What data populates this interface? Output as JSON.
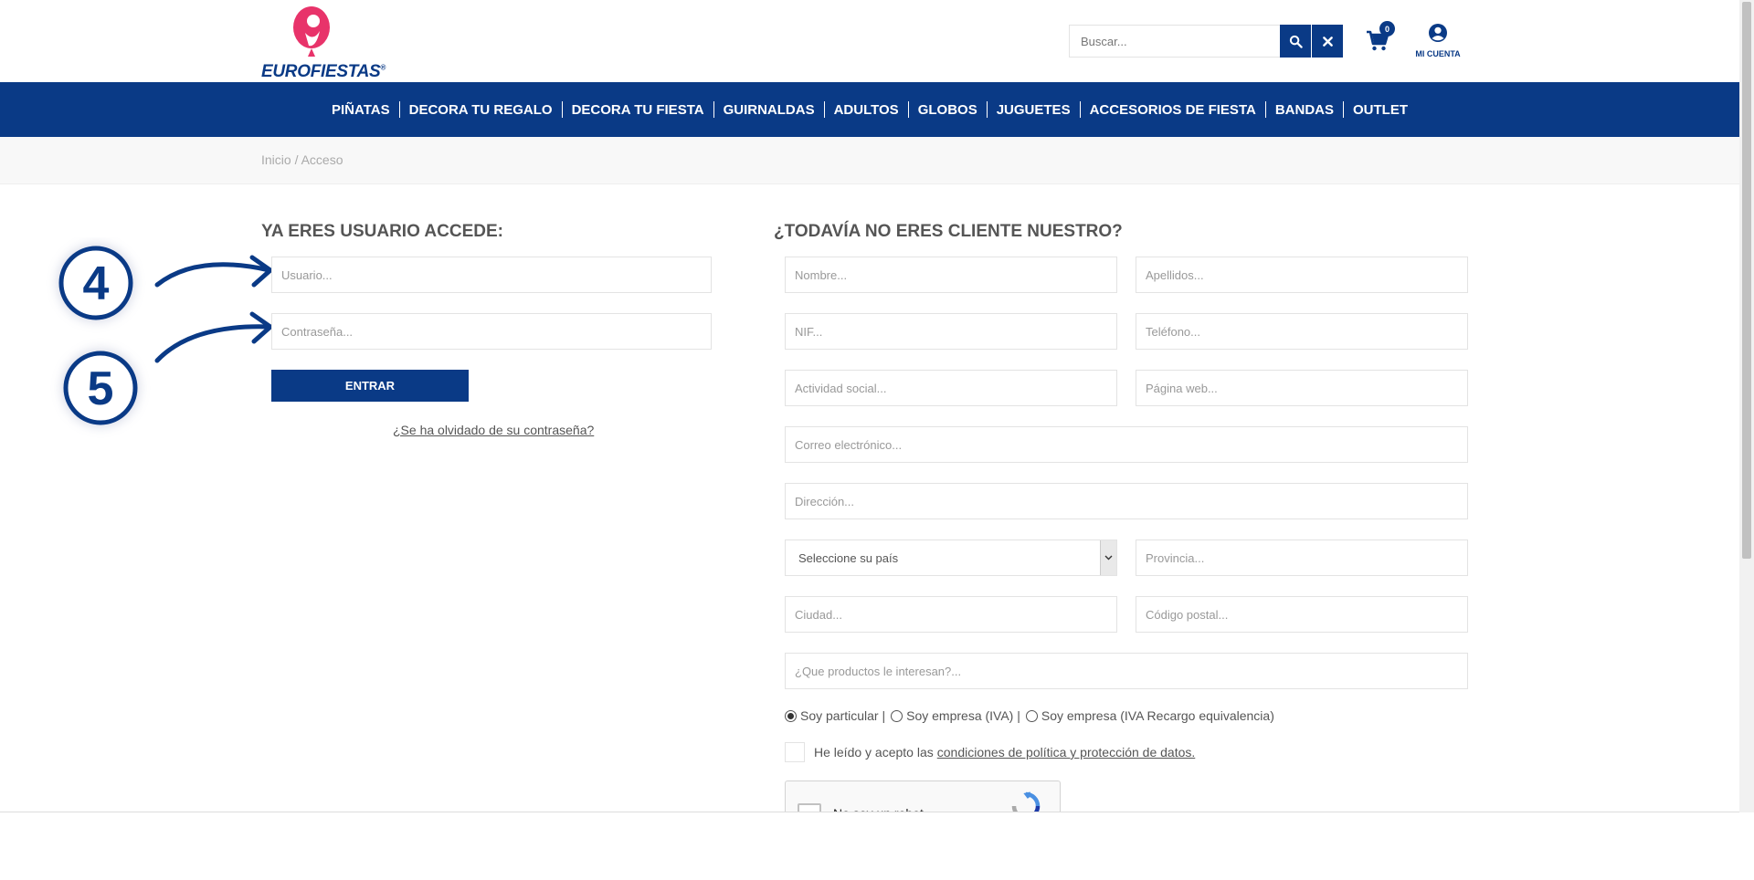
{
  "brand": {
    "name": "EUROFIESTAS",
    "registered": "®",
    "color": "#0a3a86",
    "accent": "#e8336a"
  },
  "header": {
    "search_placeholder": "Buscar...",
    "cart_count": "0",
    "account_label": "MI CUENTA"
  },
  "nav": [
    "PIÑATAS",
    "DECORA TU REGALO",
    "DECORA TU FIESTA",
    "GUIRNALDAS",
    "ADULTOS",
    "GLOBOS",
    "JUGUETES",
    "ACCESORIOS DE FIESTA",
    "BANDAS",
    "OUTLET"
  ],
  "breadcrumb": {
    "home": "Inicio",
    "sep": " / ",
    "current": "Acceso"
  },
  "login": {
    "title": "YA ERES USUARIO ACCEDE:",
    "user_placeholder": "Usuario...",
    "password_placeholder": "Contraseña...",
    "submit": "ENTRAR",
    "forgot": "¿Se ha olvidado de su contraseña?"
  },
  "annotations": {
    "one": "4",
    "two": "5"
  },
  "register": {
    "title": "¿TODAVÍA NO ERES CLIENTE NUESTRO?",
    "fields": {
      "nombre": "Nombre...",
      "apellidos": "Apellidos...",
      "nif": "NIF...",
      "telefono": "Teléfono...",
      "actividad": "Actividad social...",
      "web": "Página web...",
      "correo": "Correo electrónico...",
      "direccion": "Dirección...",
      "provincia": "Provincia...",
      "ciudad": "Ciudad...",
      "postal": "Código postal...",
      "productos": "¿Que productos le interesan?..."
    },
    "country_select": "Seleccione su país",
    "customer_types": [
      "Soy particular |",
      "Soy empresa (IVA) |",
      "Soy empresa (IVA Recargo equivalencia)"
    ],
    "consent_text": "He leído y acepto las",
    "consent_link": "condiciones de política y protección de datos.",
    "captcha_text": "No soy un robot"
  }
}
